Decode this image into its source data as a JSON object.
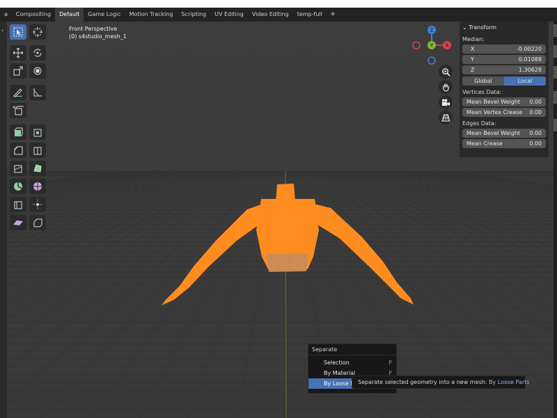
{
  "tabs": [
    {
      "label": "a",
      "active": false
    },
    {
      "label": "Compositing",
      "active": false
    },
    {
      "label": "Default",
      "active": true
    },
    {
      "label": "Game Logic",
      "active": false
    },
    {
      "label": "Motion Tracking",
      "active": false
    },
    {
      "label": "Scripting",
      "active": false
    },
    {
      "label": "UV Editing",
      "active": false
    },
    {
      "label": "Video Editing",
      "active": false
    },
    {
      "label": "temp-full",
      "active": false
    },
    {
      "label": "+",
      "active": false
    }
  ],
  "viewport": {
    "view_name": "Front Perspective",
    "object_name": "(0) s4studio_mesh_1"
  },
  "toolbar_icons": [
    "select-box-icon",
    "cursor-icon",
    "move-icon",
    "rotate-icon",
    "scale-icon",
    "transform-icon",
    "annotate-icon",
    "measure-icon",
    "add-cube-icon",
    "extrude-icon",
    "inset-icon",
    "bevel-icon",
    "loop-cut-icon",
    "knife-icon",
    "poly-build-icon",
    "spin-icon",
    "smooth-icon",
    "edge-slide-icon",
    "shrink-fatten-icon",
    "shear-icon",
    "rip-icon"
  ],
  "gizmo": {
    "z_label": "Z",
    "y_label": "Y",
    "x_label": "X"
  },
  "colors": {
    "x_axis": "#d6404e",
    "y_axis": "#84b72c",
    "z_axis": "#3c82dc",
    "mesh": "#ff8a1c",
    "accent": "#4772b3"
  },
  "transform": {
    "header": "Transform",
    "median_label": "Median:",
    "x_label": "X",
    "x_value": "-0.00220",
    "y_label": "Y",
    "y_value": "0.01088",
    "z_label": "Z",
    "z_value": "1.30628",
    "global_label": "Global",
    "local_label": "Local",
    "vertices_label": "Vertices Data:",
    "mean_bevel_weight_label": "Mean Bevel Weight",
    "vertex_bevel_value": "0.00",
    "mean_vertex_crease_label": "Mean Vertex Crease",
    "vertex_crease_value": "0.00",
    "edges_label": "Edges Data:",
    "edge_bevel_label": "Mean Bevel Weight",
    "edge_bevel_value": "0.00",
    "mean_crease_label": "Mean Crease",
    "edge_crease_value": "0.00"
  },
  "separate_menu": {
    "title": "Separate",
    "items": [
      {
        "label": "Selection",
        "key": "P"
      },
      {
        "label": "By Material",
        "key": "P"
      },
      {
        "label": "By Loose Parts",
        "key": "P"
      }
    ]
  },
  "tooltip": {
    "text": "Separate selected geometry into a new mesh:",
    "accent": "By Loose Parts"
  }
}
